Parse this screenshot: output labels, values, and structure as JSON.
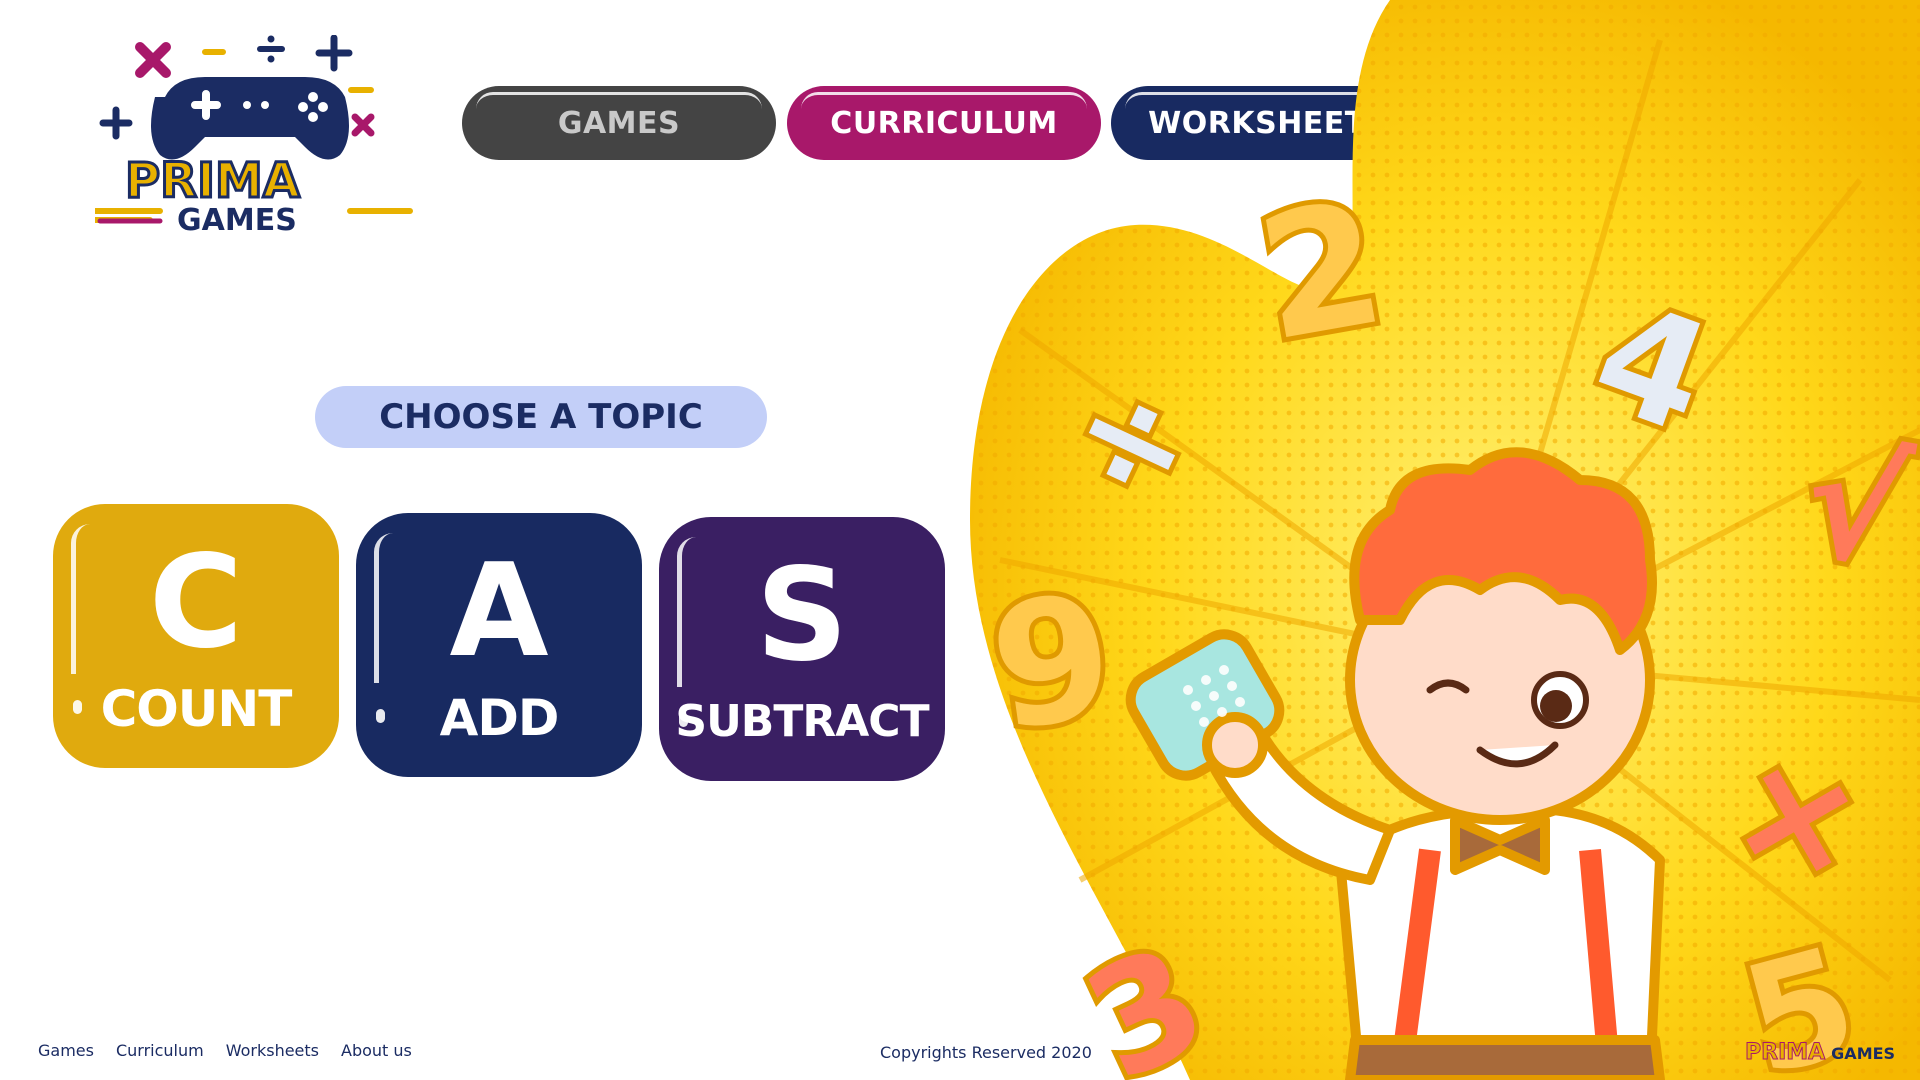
{
  "brand": {
    "logo_primary": "PRIMA",
    "logo_secondary": "GAMES"
  },
  "nav": {
    "items": [
      {
        "label": "GAMES",
        "color": "#444444"
      },
      {
        "label": "CURRICULUM",
        "color": "#a8186a"
      },
      {
        "label": "WORKSHEETS",
        "color": "#182a61"
      }
    ]
  },
  "main": {
    "heading": "CHOOSE A TOPIC",
    "topics": [
      {
        "letter": "C",
        "label": "COUNT",
        "color": "#e0aa0e"
      },
      {
        "letter": "A",
        "label": "ADD",
        "color": "#182a61"
      },
      {
        "letter": "S",
        "label": "SUBTRACT",
        "color": "#3a1f63"
      }
    ]
  },
  "footer": {
    "links": [
      "Games",
      "Curriculum",
      "Worksheets",
      "About us"
    ],
    "copyright": "Copyrights Reserved 2020",
    "logo_primary": "PRIMA",
    "logo_secondary": "GAMES"
  },
  "illustration": {
    "subject": "boy-with-calculator",
    "symbols": [
      "2",
      "4",
      "9",
      "3",
      "5",
      "÷",
      "×",
      "√"
    ]
  }
}
